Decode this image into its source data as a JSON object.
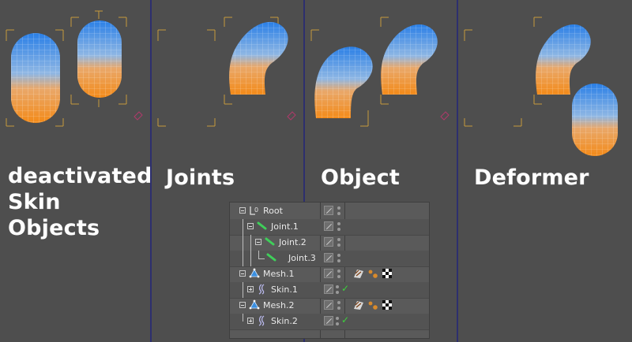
{
  "panels": [
    {
      "caption_lines": [
        "deactivated",
        "Skin Objects"
      ]
    },
    {
      "caption_lines": [
        "Joints"
      ]
    },
    {
      "caption_lines": [
        "Object"
      ]
    },
    {
      "caption_lines": [
        "Deformer"
      ]
    }
  ],
  "object_manager": {
    "rows": [
      {
        "name": "Root",
        "icon": "null-object-icon",
        "expand": "minus"
      },
      {
        "name": "Joint.1",
        "icon": "joint-icon",
        "expand": "minus"
      },
      {
        "name": "Joint.2",
        "icon": "joint-icon",
        "expand": "minus"
      },
      {
        "name": "Joint.3",
        "icon": "joint-icon",
        "expand": "none"
      },
      {
        "name": "Mesh.1",
        "icon": "polygon-mesh-icon",
        "expand": "minus",
        "tags": [
          "phong-tag-icon",
          "weight-tag-icon",
          "material-tag-icon"
        ]
      },
      {
        "name": "Skin.1",
        "icon": "skin-deformer-icon",
        "expand": "plus",
        "checked": true
      },
      {
        "name": "Mesh.2",
        "icon": "polygon-mesh-icon",
        "expand": "minus",
        "tags": [
          "phong-tag-icon",
          "weight-tag-icon",
          "material-tag-icon"
        ]
      },
      {
        "name": "Skin.2",
        "icon": "skin-deformer-icon",
        "expand": "plus",
        "checked": true
      }
    ]
  },
  "colors": {
    "mesh_top": "#2f86e8",
    "mesh_bottom": "#f5901f",
    "joint_bone": "#c79a3c",
    "panel_divider": "#2d2f6e"
  }
}
